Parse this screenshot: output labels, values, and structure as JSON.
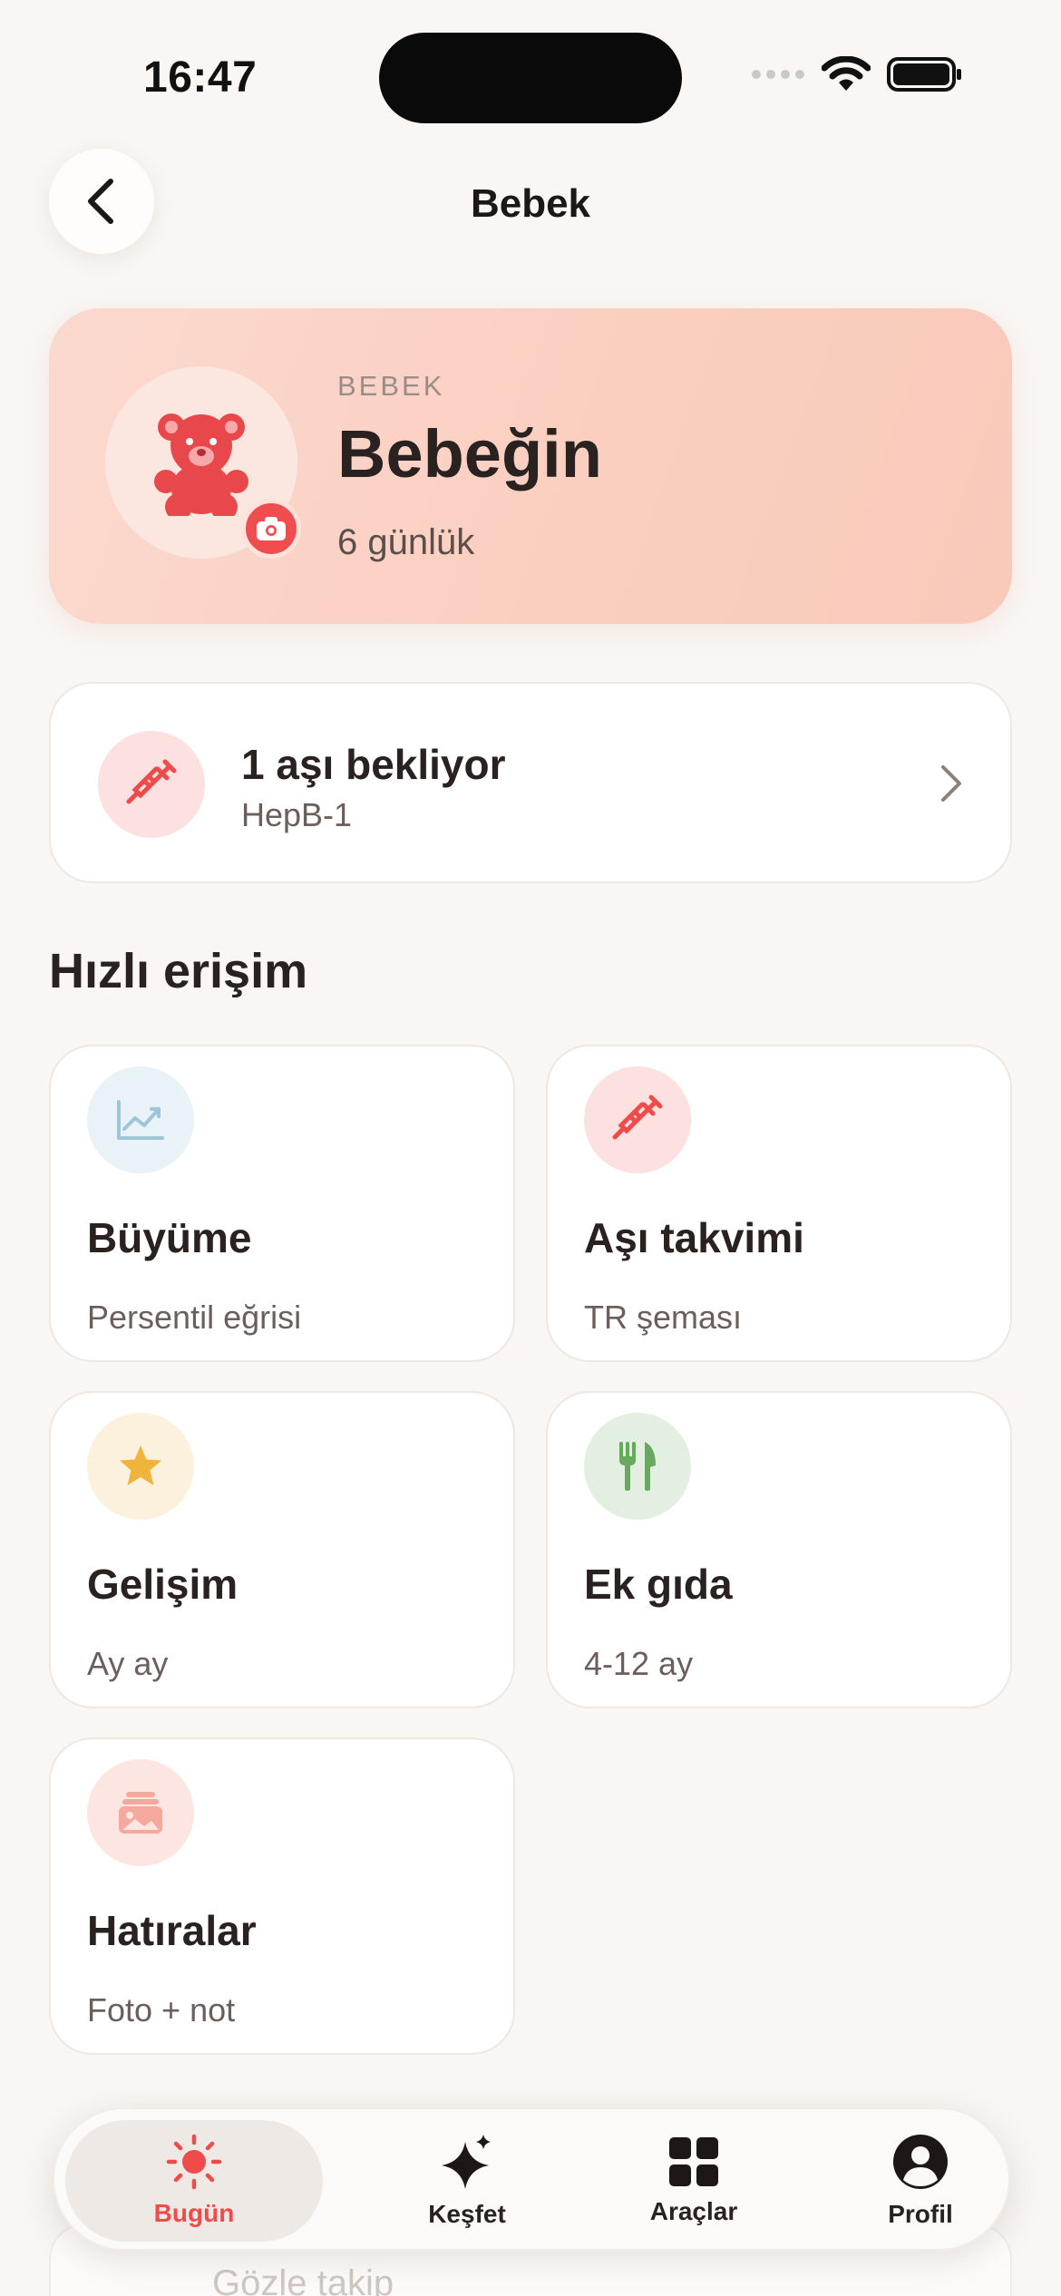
{
  "status_bar": {
    "time": "16:47"
  },
  "nav": {
    "title": "Bebek"
  },
  "hero": {
    "kicker": "BEBEK",
    "name": "Bebeğin",
    "age": "6 günlük"
  },
  "vaccine_card": {
    "title": "1 aşı bekliyor",
    "subtitle": "HepB-1"
  },
  "quick_access": {
    "title": "Hızlı erişim",
    "tiles": [
      {
        "title": "Büyüme",
        "subtitle": "Persentil eğrisi",
        "icon": "chart-line-icon",
        "color": "#e9f2f6"
      },
      {
        "title": "Aşı takvimi",
        "subtitle": "TR şeması",
        "icon": "syringe-icon",
        "color": "#fde0e0"
      },
      {
        "title": "Gelişim",
        "subtitle": "Ay ay",
        "icon": "star-icon",
        "color": "#fbf1dc"
      },
      {
        "title": "Ek gıda",
        "subtitle": "4-12 ay",
        "icon": "fork-knife-icon",
        "color": "#e3efe1"
      },
      {
        "title": "Hatıralar",
        "subtitle": "Foto + not",
        "icon": "photo-album-icon",
        "color": "#fde6e2"
      }
    ]
  },
  "background_content": {
    "card_text": "Gözle takip"
  },
  "tab_bar": {
    "tabs": [
      {
        "label": "Bugün",
        "icon": "sun-icon",
        "active": true
      },
      {
        "label": "Keşfet",
        "icon": "sparkle-icon",
        "active": false
      },
      {
        "label": "Araçlar",
        "icon": "grid-icon",
        "active": false
      },
      {
        "label": "Profil",
        "icon": "person-icon",
        "active": false
      }
    ]
  },
  "colors": {
    "accent": "#ef4b4b",
    "background": "#f9f6f3",
    "hero_gradient_start": "#fbd9cf",
    "hero_gradient_end": "#f9c9ba"
  }
}
